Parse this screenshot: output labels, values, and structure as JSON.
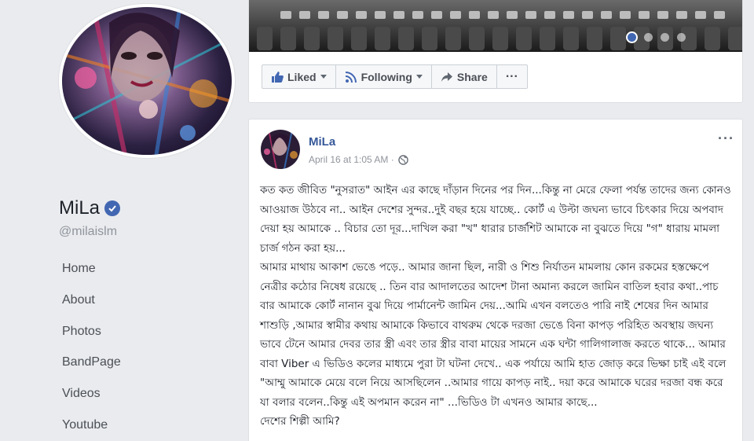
{
  "profile": {
    "name": "MiLa",
    "handle": "@milaislm"
  },
  "nav": {
    "items": [
      "Home",
      "About",
      "Photos",
      "BandPage",
      "Videos",
      "Youtube"
    ]
  },
  "cover": {
    "slide_count": 4,
    "active_slide": 1
  },
  "actions": {
    "liked": "Liked",
    "following": "Following",
    "share": "Share",
    "more": "···"
  },
  "post": {
    "author": "MiLa",
    "timestamp": "April 16 at 1:05 AM ·",
    "more": "···",
    "text": "কত কত জীবিত \"নুসরাত\" আইন এর কাছে দাঁড়ান দিনের পর দিন...কিন্তু না মেরে ফেলা পর্যন্ত তাদের জন্য কোনও আওয়াজ উঠবে না.. আইন দেশের সুন্দর..দুই বছর হয়ে যাচ্ছে.. কোর্ট এ উল্টা জঘন্য ভাবে চিৎকার দিয়ে অপবাদ দেয়া হয় আমাকে .. বিচার তো দূর...দাখিল করা \"খ\" ধারার চার্জশিট আমাকে না বুঝতে দিয়ে \"গ\" ধারায় মামলা চার্জ গঠন করা হয়...\nআমার মাথায় আকাশ ভেঙে পড়ে.. আমার জানা ছিল, নারী ও শিশু নির্যাতন মামলায় কোন রকমের হস্তক্ষেপে নেত্রীর কঠোর নিষেধ রয়েছে .. তিন বার আদালতের আদেশ টানা অমান্য করলে জামিন বাতিল হবার কথা..পাচ বার আমাকে কোর্ট নানান বুঝ দিয়ে পার্মানেন্ট জামিন দেয়...আমি এখন বলতেও পারি নাই শেষের দিন আমার শাশুড়ি ,আমার স্বামীর কথায় আমাকে কিভাবে বাথরুম থেকে দরজা ভেঙে বিনা কাপড় পরিহিত অবস্থায় জঘন্য ভাবে টেনে আমার দেবর তার স্ত্রী এবং তার স্ত্রীর বাবা মায়ের সামনে এক ঘন্টা গালিগালাজ করতে থাকে... আমার বাবা Viber এ ভিডিও কলের মাধ্যমে পুরা টা ঘটনা দেখে.. এক পর্যায়ে আমি হাত জোড় করে ভিক্ষা চাই এই বলে \"আম্মু আমাকে মেয়ে বলে নিয়ে আসছিলেন ..আমার গায়ে কাপড় নাই.. দয়া করে আমাকে ঘরের দরজা বন্ধ করে যা বলার বলেন..কিন্তু এই অপমান করেন না\" ...ভিডিও টা এখনও আমার কাছে...\nদেশের শিল্পী আমি?"
  },
  "colors": {
    "page_bg": "#e9ebee",
    "link_blue": "#365899",
    "brand_blue": "#4267b2",
    "meta_gray": "#90949c"
  },
  "icons": {
    "verified": "verified-badge-icon",
    "like": "thumbs-up-icon",
    "following": "rss-feed-icon",
    "share": "share-arrow-icon",
    "privacy": "globe-icon"
  }
}
